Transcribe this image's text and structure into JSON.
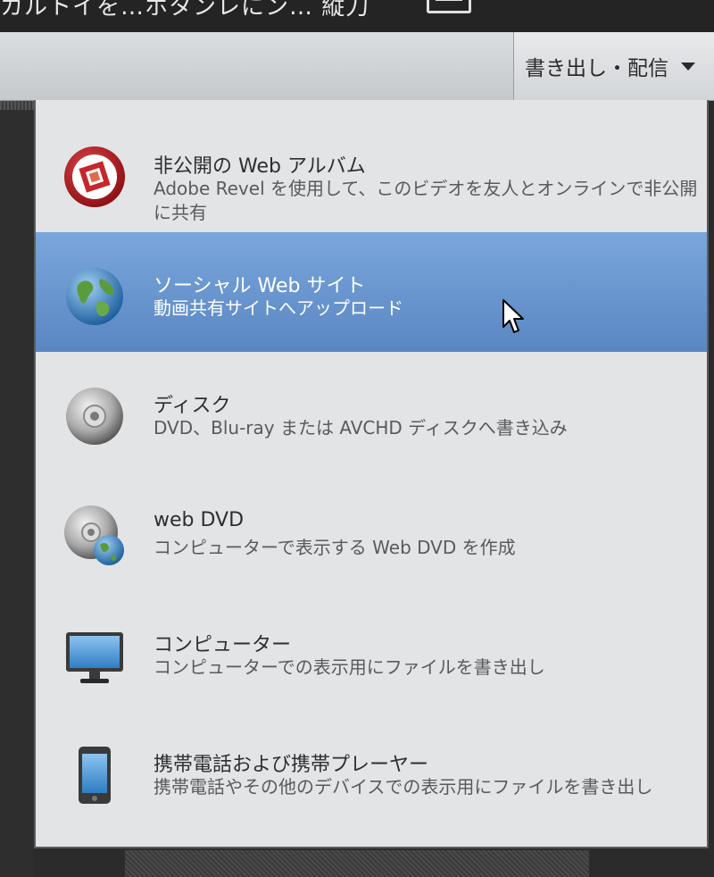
{
  "topbar": {
    "title": "カルトイを…ホタンレにン…  縦刀"
  },
  "toolbar": {
    "export_label": "書き出し・配信"
  },
  "menu": {
    "items": [
      {
        "icon": "revel-album-icon",
        "title": "非公開の Web アルバム",
        "description": "Adobe Revel を使用して、このビデオを友人とオンラインで非公開に共有"
      },
      {
        "icon": "globe-icon",
        "title": "ソーシャル Web サイト",
        "description": "動画共有サイトへアップロード",
        "selected": true
      },
      {
        "icon": "disc-icon",
        "title": "ディスク",
        "description": "DVD、Blu-ray または AVCHD ディスクへ書き込み"
      },
      {
        "icon": "web-dvd-icon",
        "title": "web DVD",
        "description": "コンピューターで表示する Web DVD を作成"
      },
      {
        "icon": "monitor-icon",
        "title": "コンピューター",
        "description": "コンピューターでの表示用にファイルを書き出し"
      },
      {
        "icon": "mobile-phone-icon",
        "title": "携帯電話および携帯プレーヤー",
        "description": "携帯電話やその他のデバイスでの表示用にファイルを書き出し"
      }
    ]
  },
  "colors": {
    "selected": "#6b97cf",
    "menu_bg": "#e3e4e6"
  }
}
